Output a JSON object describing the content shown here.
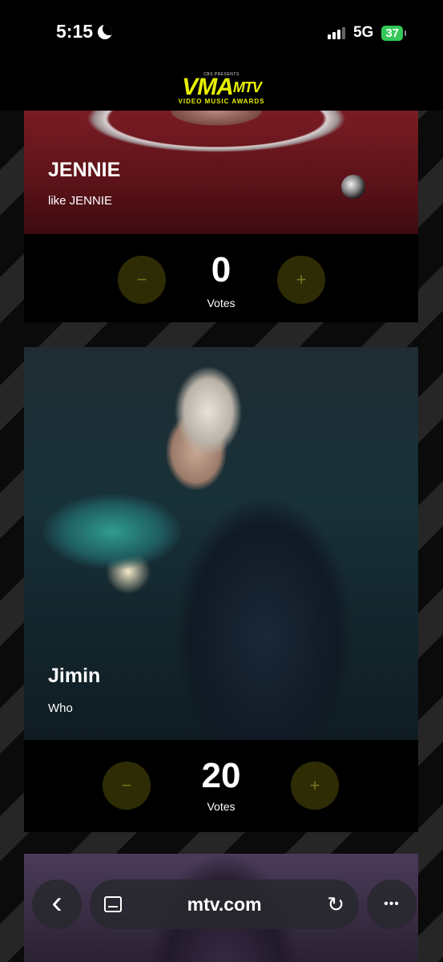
{
  "status_bar": {
    "time": "5:15",
    "network": "5G",
    "battery": "37"
  },
  "header": {
    "presents": "CBS PRESENTS",
    "logo": "VMA",
    "logo_mtv": "MTV",
    "subtitle": "VIDEO MUSIC AWARDS"
  },
  "cards": [
    {
      "artist": "JENNIE",
      "song": "like JENNIE",
      "votes": "0",
      "votes_label": "Votes",
      "minus": "−",
      "plus": "+"
    },
    {
      "artist": "Jimin",
      "song": "Who",
      "votes": "20",
      "votes_label": "Votes",
      "minus": "−",
      "plus": "+"
    }
  ],
  "browser": {
    "url": "mtv.com",
    "back": "‹",
    "more": "•••",
    "reload": "↻"
  },
  "colors": {
    "accent": "#e6f000",
    "vote_button_bg": "#2e2c05",
    "battery": "#34c759"
  }
}
